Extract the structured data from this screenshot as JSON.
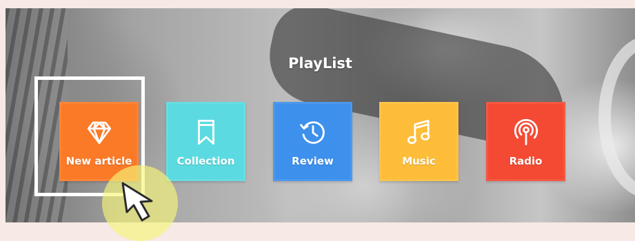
{
  "section": {
    "title": "PlayList"
  },
  "tiles": [
    {
      "label": "New article",
      "icon": "diamond-icon",
      "color": "#fb7a27"
    },
    {
      "label": "Collection",
      "icon": "bookmark-icon",
      "color": "#5bdbe1"
    },
    {
      "label": "Review",
      "icon": "history-icon",
      "color": "#3d90ec"
    },
    {
      "label": "Music",
      "icon": "music-note-icon",
      "color": "#fdbd39"
    },
    {
      "label": "Radio",
      "icon": "radio-broadcast-icon",
      "color": "#f44a34"
    }
  ],
  "colors": {
    "highlight_border": "#ffffff",
    "cursor_halo": "#f6f678"
  }
}
